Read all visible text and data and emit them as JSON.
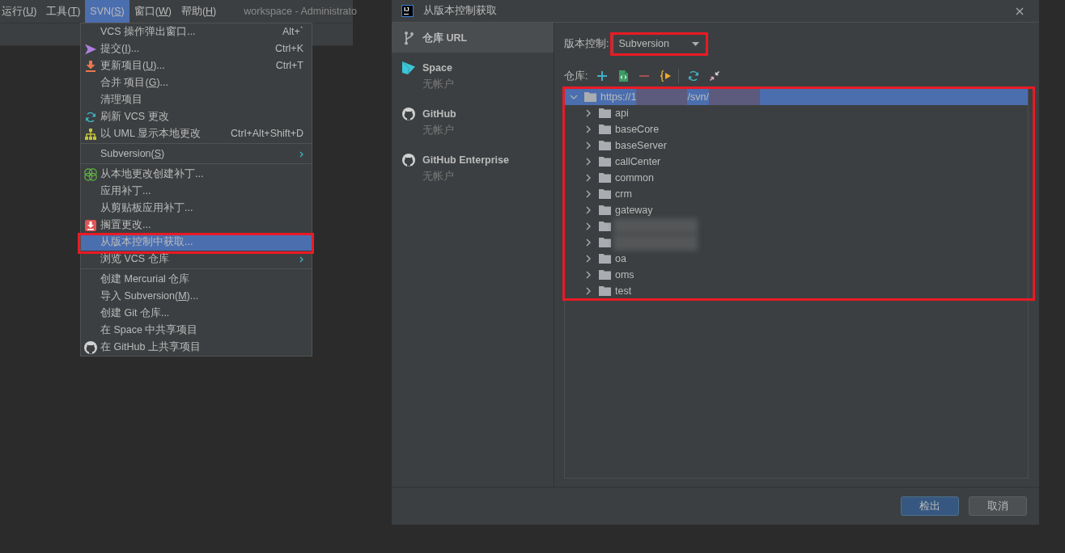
{
  "ide": {
    "menubar": [
      {
        "label": "运行(U)",
        "selected": false
      },
      {
        "label": "工具(T)",
        "selected": false
      },
      {
        "label": "SVN(S)",
        "selected": true
      },
      {
        "label": "窗口(W)",
        "selected": false
      },
      {
        "label": "帮助(H)",
        "selected": false
      }
    ],
    "title": "workspace - Administrato"
  },
  "menu": {
    "groups": [
      [
        {
          "kind": "plain",
          "label": "VCS 操作弹出窗口...",
          "shortcut": "Alt+`",
          "selected": false,
          "marked": false
        },
        {
          "kind": "commit",
          "label": "提交(I)...",
          "shortcut": "Ctrl+K",
          "selected": false,
          "marked": false
        },
        {
          "kind": "update",
          "label": "更新项目(U)...",
          "shortcut": "Ctrl+T",
          "selected": false,
          "marked": false
        },
        {
          "kind": "plain",
          "label": "合并 项目(G)...",
          "selected": false,
          "marked": false
        },
        {
          "kind": "plain",
          "label": "清理项目",
          "selected": false,
          "marked": false
        },
        {
          "kind": "refresh",
          "label": "刷新 VCS 更改",
          "selected": false,
          "marked": false
        },
        {
          "kind": "uml",
          "label": "以 UML 显示本地更改",
          "shortcut": "Ctrl+Alt+Shift+D",
          "selected": false,
          "marked": false
        }
      ],
      [
        {
          "kind": "submenu",
          "label": "Subversion(S)",
          "selected": false,
          "marked": false
        }
      ],
      [
        {
          "kind": "patch",
          "label": "从本地更改创建补丁...",
          "selected": false,
          "marked": false
        },
        {
          "kind": "plain",
          "label": "应用补丁...",
          "selected": false,
          "marked": false
        },
        {
          "kind": "plain",
          "label": "从剪贴板应用补丁...",
          "selected": false,
          "marked": false
        },
        {
          "kind": "shelve",
          "label": "搁置更改...",
          "selected": false,
          "marked": false
        },
        {
          "kind": "plain",
          "label": "从版本控制中获取...",
          "selected": true,
          "marked": true
        },
        {
          "kind": "submenu",
          "label": "浏览 VCS 仓库",
          "selected": false,
          "marked": false
        }
      ],
      [
        {
          "kind": "plain",
          "label": "创建 Mercurial 仓库",
          "selected": false,
          "marked": false
        },
        {
          "kind": "plain",
          "label": "导入 Subversion(M)...",
          "selected": false,
          "marked": false
        },
        {
          "kind": "plain",
          "label": "创建 Git 仓库...",
          "selected": false,
          "marked": false
        },
        {
          "kind": "plain",
          "label": "在 Space 中共享项目",
          "selected": false,
          "marked": false
        },
        {
          "kind": "github",
          "label": "在 GitHub 上共享项目",
          "selected": false,
          "marked": false
        }
      ]
    ]
  },
  "dialog": {
    "logo": "IJ",
    "title": "从版本控制获取",
    "sidebar": {
      "items": [
        {
          "kind": "url",
          "label": "仓库 URL",
          "selected": true
        },
        {
          "kind": "space",
          "label": "Space",
          "account": "无帐户",
          "selected": false
        },
        {
          "kind": "github",
          "label": "GitHub",
          "account": "无帐户",
          "selected": false
        },
        {
          "kind": "github",
          "label": "GitHub Enterprise",
          "account": "无帐户",
          "selected": false
        }
      ]
    },
    "vcs": {
      "label": "版本控制:",
      "value": "Subversion",
      "marked": true
    },
    "repository": {
      "label": "仓库:",
      "tree": {
        "marked": true,
        "nodes": [
          {
            "label_parts": [
              {
                "kind": "text",
                "text": "https://1"
              },
              {
                "kind": "redacted"
              },
              {
                "kind": "text",
                "text": "/svn/"
              },
              {
                "kind": "redacted"
              }
            ],
            "expanded": true,
            "selected": true,
            "children": [
              {
                "label": "api",
                "expanded": false,
                "selected": false,
                "redacted": false
              },
              {
                "label": "baseCore",
                "expanded": false,
                "selected": false,
                "redacted": false
              },
              {
                "label": "baseServer",
                "expanded": false,
                "selected": false,
                "redacted": false
              },
              {
                "label": "callCenter",
                "expanded": false,
                "selected": false,
                "redacted": false
              },
              {
                "label": "common",
                "expanded": false,
                "selected": false,
                "redacted": false
              },
              {
                "label": "crm",
                "expanded": false,
                "selected": false,
                "redacted": false
              },
              {
                "label": "gateway",
                "expanded": false,
                "selected": false,
                "redacted": false
              },
              {
                "expanded": false,
                "selected": false,
                "redacted": true
              },
              {
                "expanded": false,
                "selected": false,
                "redacted": true
              },
              {
                "label": "oa",
                "expanded": false,
                "selected": false,
                "redacted": false
              },
              {
                "label": "oms",
                "expanded": false,
                "selected": false,
                "redacted": false
              },
              {
                "label": "test",
                "expanded": false,
                "selected": false,
                "redacted": false
              }
            ]
          }
        ]
      }
    },
    "buttons": [
      {
        "kind": "checkout",
        "label": "检出"
      },
      {
        "kind": "cancel",
        "label": "取消"
      }
    ]
  }
}
